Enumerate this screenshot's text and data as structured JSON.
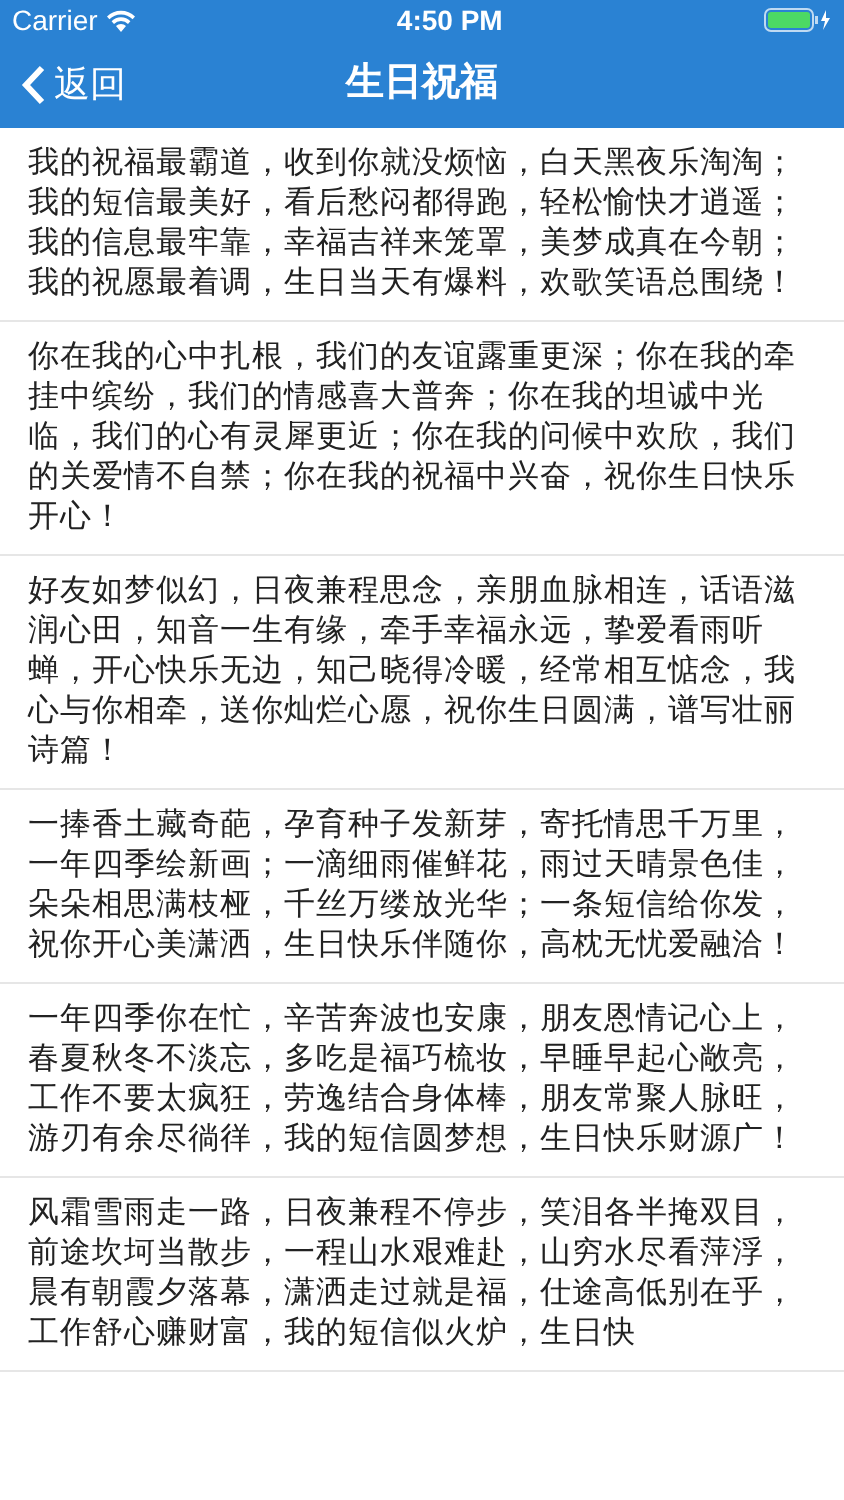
{
  "status_bar": {
    "carrier": "Carrier",
    "time": "4:50 PM"
  },
  "nav_bar": {
    "back": "返回",
    "title": "生日祝福"
  },
  "messages": [
    "我的祝福最霸道，收到你就没烦恼，白天黑夜乐淘淘；我的短信最美好，看后愁闷都得跑，轻松愉快才逍遥；我的信息最牢靠，幸福吉祥来笼罩，美梦成真在今朝；我的祝愿最着调，生日当天有爆料，欢歌笑语总围绕！",
    "你在我的心中扎根，我们的友谊露重更深；你在我的牵挂中缤纷，我们的情感喜大普奔；你在我的坦诚中光临，我们的心有灵犀更近；你在我的问候中欢欣，我们的关爱情不自禁；你在我的祝福中兴奋，祝你生日快乐开心！",
    "好友如梦似幻，日夜兼程思念，亲朋血脉相连，话语滋润心田，知音一生有缘，牵手幸福永远，挚爱看雨听蝉，开心快乐无边，知己晓得冷暖，经常相互惦念，我心与你相牵，送你灿烂心愿，祝你生日圆满，谱写壮丽诗篇！",
    "一捧香土藏奇葩，孕育种子发新芽，寄托情思千万里，一年四季绘新画；一滴细雨催鲜花，雨过天晴景色佳，朵朵相思满枝桠，千丝万缕放光华；一条短信给你发，祝你开心美潇洒，生日快乐伴随你，高枕无忧爱融洽！",
    "一年四季你在忙，辛苦奔波也安康，朋友恩情记心上，春夏秋冬不淡忘，多吃是福巧梳妆，早睡早起心敞亮，工作不要太疯狂，劳逸结合身体棒，朋友常聚人脉旺，游刃有余尽徜徉，我的短信圆梦想，生日快乐财源广！",
    "风霜雪雨走一路，日夜兼程不停步，笑泪各半掩双目，前途坎坷当散步，一程山水艰难赴，山穷水尽看萍浮，晨有朝霞夕落幕，潇洒走过就是福，仕途高低别在乎，工作舒心赚财富，我的短信似火炉，生日快"
  ]
}
